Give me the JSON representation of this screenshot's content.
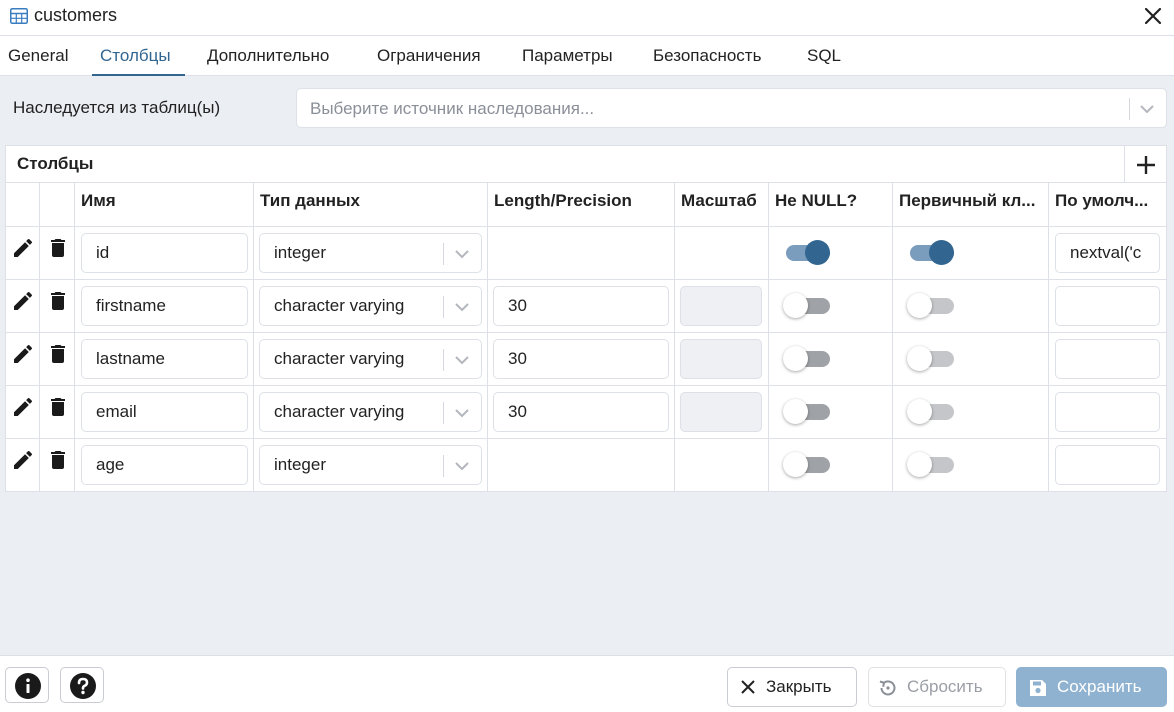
{
  "window": {
    "title": "customers",
    "icon": "table-icon"
  },
  "tabs": [
    {
      "label": "General",
      "active": false
    },
    {
      "label": "Столбцы",
      "active": true
    },
    {
      "label": "Дополнительно",
      "active": false
    },
    {
      "label": "Ограничения",
      "active": false
    },
    {
      "label": "Параметры",
      "active": false
    },
    {
      "label": "Безопасность",
      "active": false
    },
    {
      "label": "SQL",
      "active": false
    }
  ],
  "inherit": {
    "label": "Наследуется из таблиц(ы)",
    "placeholder": "Выберите источник наследования..."
  },
  "columns_grid": {
    "title": "Столбцы",
    "headers": {
      "name": "Имя",
      "type": "Тип данных",
      "length": "Length/Precision",
      "scale": "Масштаб",
      "notnull": "Не NULL?",
      "pk": "Первичный кл...",
      "default": "По умолч..."
    },
    "rows": [
      {
        "name": "id",
        "type": "integer",
        "length": "",
        "length_editable": false,
        "scale_editable": false,
        "notnull": true,
        "pk": true,
        "default": "nextval('c"
      },
      {
        "name": "firstname",
        "type": "character varying",
        "length": "30",
        "length_editable": true,
        "scale_editable": true,
        "notnull": false,
        "pk": false,
        "default": ""
      },
      {
        "name": "lastname",
        "type": "character varying",
        "length": "30",
        "length_editable": true,
        "scale_editable": true,
        "notnull": false,
        "pk": false,
        "default": ""
      },
      {
        "name": "email",
        "type": "character varying",
        "length": "30",
        "length_editable": true,
        "scale_editable": true,
        "notnull": false,
        "pk": false,
        "default": ""
      },
      {
        "name": "age",
        "type": "integer",
        "length": "",
        "length_editable": false,
        "scale_editable": false,
        "notnull": false,
        "pk": false,
        "default": ""
      }
    ]
  },
  "footer": {
    "close_label": "Закрыть",
    "reset_label": "Сбросить",
    "save_label": "Сохранить"
  },
  "colors": {
    "accent": "#326690",
    "save_button_bg": "#8fb2d1",
    "toggle_on_track": "#7a9cbd",
    "toggle_off_track": "#9fa2a6"
  }
}
